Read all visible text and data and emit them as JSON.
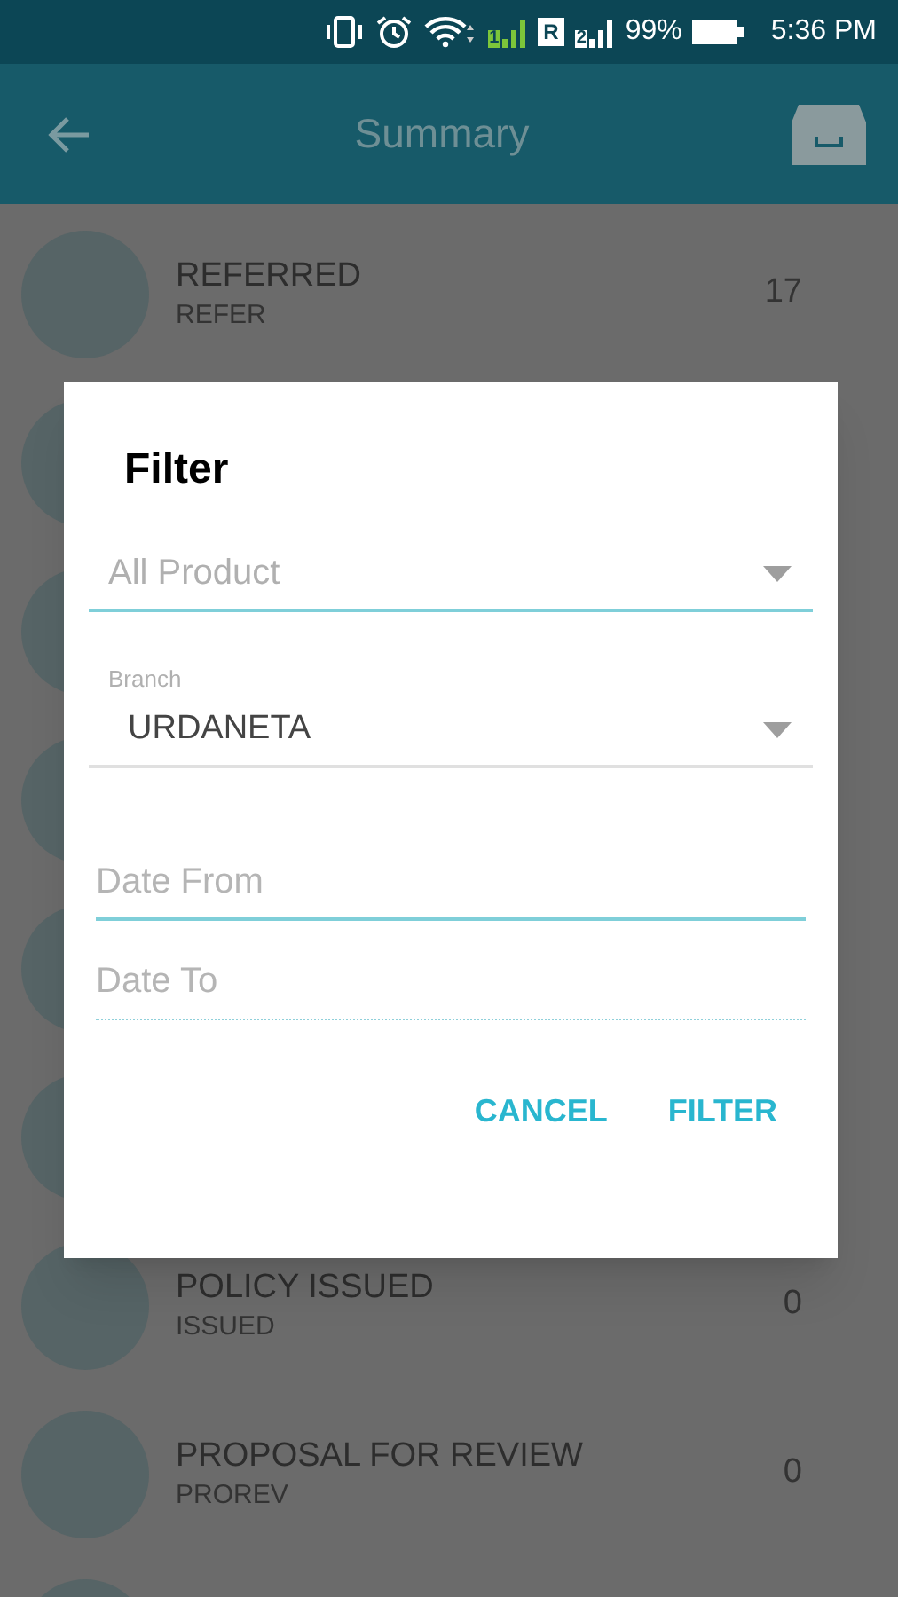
{
  "status_bar": {
    "sim1": "1",
    "roaming": "R",
    "sim2": "2",
    "battery": "99%",
    "time": "5:36 PM"
  },
  "toolbar": {
    "title": "Summary"
  },
  "rows": [
    {
      "kind": "item",
      "title": "REFERRED",
      "code": "REFER",
      "count": "17"
    },
    {
      "kind": "covered"
    },
    {
      "kind": "covered"
    },
    {
      "kind": "covered"
    },
    {
      "kind": "covered"
    },
    {
      "kind": "covered"
    },
    {
      "kind": "item",
      "title": "POLICY ISSUED",
      "code": "ISSUED",
      "count": "0"
    },
    {
      "kind": "item",
      "title": "PROPOSAL FOR REVIEW",
      "code": "PROREV",
      "count": "0"
    },
    {
      "kind": "covered"
    }
  ],
  "dialog": {
    "title": "Filter",
    "fields": [
      {
        "kind": "select",
        "placeholder": "All Product",
        "focused": true,
        "disabled": false
      },
      {
        "kind": "select",
        "label": "Branch",
        "value": "URDANETA",
        "focused": false,
        "disabled": false
      },
      {
        "kind": "text",
        "placeholder": "Date From",
        "focused": true,
        "disabled": false
      },
      {
        "kind": "text",
        "placeholder": "Date To",
        "focused": false,
        "disabled": true
      }
    ],
    "buttons": [
      "CANCEL",
      "FILTER"
    ]
  }
}
